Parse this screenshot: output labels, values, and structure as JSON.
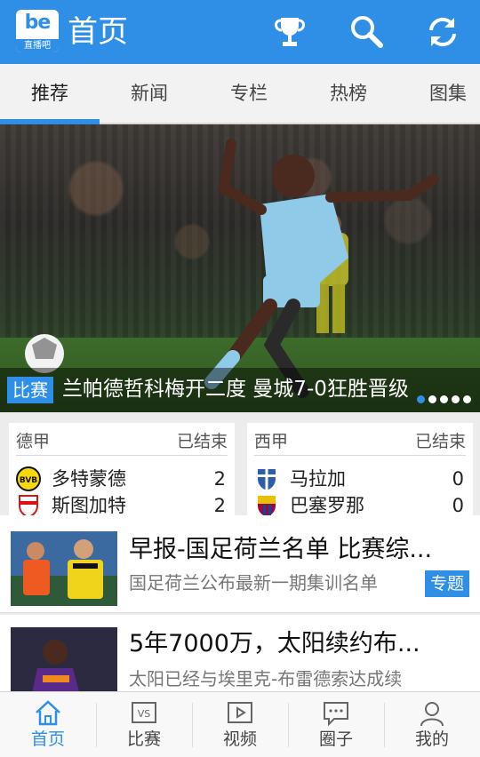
{
  "header": {
    "logo_mark": "be",
    "logo_sub": "直播吧",
    "title": "首页",
    "actions": [
      "trophy-icon",
      "search-icon",
      "refresh-icon"
    ]
  },
  "tabs": [
    {
      "label": "推荐",
      "active": true
    },
    {
      "label": "新闻",
      "active": false
    },
    {
      "label": "专栏",
      "active": false
    },
    {
      "label": "热榜",
      "active": false
    },
    {
      "label": "图集",
      "active": false
    }
  ],
  "hero": {
    "badge": "比赛",
    "title": "兰帕德哲科梅开二度 曼城7-0狂胜晋级",
    "slide_count": 5,
    "active_slide": 1
  },
  "matches": [
    {
      "league": "德甲",
      "status": "已结束",
      "home": {
        "name": "多特蒙德",
        "score": "2"
      },
      "away": {
        "name": "斯图加特",
        "score": "2"
      }
    },
    {
      "league": "西甲",
      "status": "已结束",
      "home": {
        "name": "马拉加",
        "score": "0"
      },
      "away": {
        "name": "巴塞罗那",
        "score": "0"
      }
    }
  ],
  "news": [
    {
      "title": "早报-国足荷兰名单 比赛综...",
      "desc": "国足荷兰公布最新一期集训名单",
      "desc2": "",
      "tag": "专题"
    },
    {
      "title": "5年7000万，太阳续约布...",
      "desc": "太阳已经与埃里克-布雷德索达成续",
      "desc2": ""
    }
  ],
  "bottom_nav": [
    {
      "label": "首页",
      "icon": "home-icon",
      "active": true
    },
    {
      "label": "比赛",
      "icon": "vs-icon",
      "active": false
    },
    {
      "label": "视频",
      "icon": "video-icon",
      "active": false
    },
    {
      "label": "圈子",
      "icon": "chat-icon",
      "active": false
    },
    {
      "label": "我的",
      "icon": "user-icon",
      "active": false
    }
  ],
  "colors": {
    "accent": "#2f8fe6",
    "header": "#2f8fe6"
  }
}
